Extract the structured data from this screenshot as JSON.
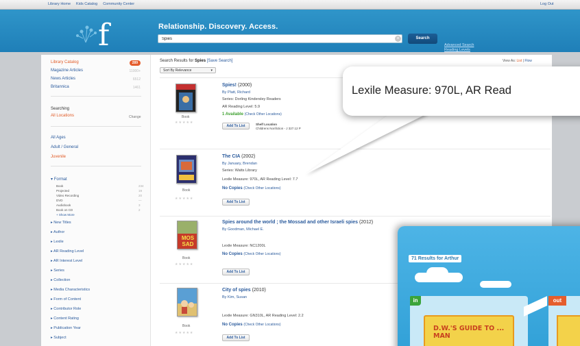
{
  "topnav": {
    "links": [
      "Library Home",
      "Kids Catalog",
      "Community Center"
    ],
    "logout": "Log Out"
  },
  "header": {
    "tagline": "Relationship. Discovery. Access.",
    "search_value": "Spies",
    "search_button": "Search",
    "advanced": "Advanced Search",
    "reading_levels": "Reading Levels"
  },
  "sidebar": {
    "sources": [
      {
        "label": "Library Catalog",
        "count": "289",
        "active": true
      },
      {
        "label": "Magazine Articles",
        "count": "11000+"
      },
      {
        "label": "News Articles",
        "count": "6512"
      },
      {
        "label": "Britannica",
        "count": "1461"
      }
    ],
    "searching_label": "Searching",
    "location": "All Locations",
    "change": "Change",
    "audiences": [
      "All Ages",
      "Adult / General",
      "Juvenile"
    ],
    "format_heading": "Format",
    "formats": [
      {
        "label": "Book",
        "count": "234"
      },
      {
        "label": "Projected",
        "count": "19"
      },
      {
        "label": "Video Recording",
        "count": "20"
      },
      {
        "label": "DVD",
        "count": "—"
      },
      {
        "label": "Audiobook",
        "count": "3"
      },
      {
        "label": "Book on CD",
        "count": "2"
      }
    ],
    "show_more": "+ Show More",
    "facets": [
      "New Titles",
      "Author",
      "Lexile",
      "AR Reading Level",
      "AR Interest Level",
      "Series",
      "Collection",
      "Media Characteristics",
      "Form of Content",
      "Contributor Role",
      "Content Rating",
      "Publication Year",
      "Subject"
    ]
  },
  "results": {
    "heading_prefix": "Search Results for",
    "query": "Spies",
    "save_search": "[Save Search]",
    "view_as_label": "View As:",
    "view_list": "List",
    "view_sep": "|",
    "view_flow": "Flow",
    "sort": "Sort By Relevance",
    "items": [
      {
        "title": "Spies!",
        "year": "(2000)",
        "author": "By Platt, Richard",
        "series": "Series: Dorling Kindersley Readers",
        "level": "AR Reading Level: 5.9",
        "availability": "1 Available",
        "other": "(Check Other Locations)",
        "format": "Book",
        "add": "Add To List",
        "shelf_label": "Shelf Location",
        "shelf_value": "Childrens Nonfiction - J 327.12 P"
      },
      {
        "title": "The CIA",
        "year": "(2002)",
        "author": "By January, Brendan",
        "series": "Series: Watts Library",
        "level": "Lexile Measure: 970L, AR Reading Level: 7.7",
        "availability": "No Copies",
        "other": "(Check Other Locations)",
        "format": "Book",
        "add": "Add To List"
      },
      {
        "title": "Spies around the world ; the Mossad and other Israeli spies",
        "year": "(2012)",
        "author": "By Goodman, Michael E.",
        "level": "Lexile Measure: NC1200L",
        "availability": "No Copies",
        "other": "(Check Other Locations)",
        "format": "Book",
        "add": "Add To List",
        "cover_text": "MOS SAD"
      },
      {
        "title": "City of spies",
        "year": "(2010)",
        "author": "By Kim, Susan",
        "level": "Lexile Measure: GN310L, AR Reading Level: 2.2",
        "availability": "No Copies",
        "other": "(Check Other Locations)",
        "format": "Book",
        "add": "Add To List"
      }
    ],
    "star_glyphs": "★★★★★"
  },
  "callout": {
    "text": "Lexile Measure: 970L, AR Read"
  },
  "kids_panel": {
    "title": "71 Results for Arthur",
    "in_label": "in",
    "out_label": "out",
    "book_title": "D.W.'S GUIDE TO ... MAN"
  },
  "colors": {
    "header_blue": "#2a8cc4",
    "accent_orange": "#e55d2c",
    "available_green": "#3a9e2b",
    "link_blue": "#2a5a9c"
  }
}
